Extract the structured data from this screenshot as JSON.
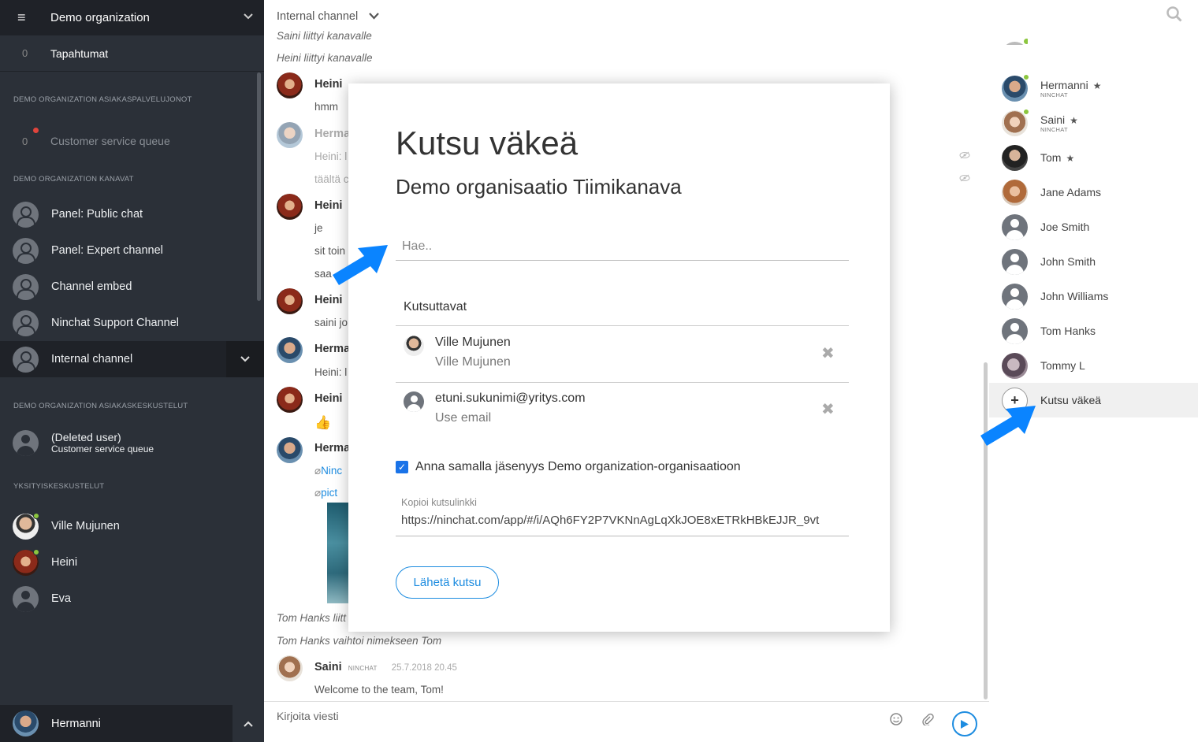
{
  "sidebar": {
    "org_name": "Demo organization",
    "events": {
      "count": "0",
      "label": "Tapahtumat"
    },
    "sections": {
      "queues": "DEMO ORGANIZATION ASIAKASPALVELUJONOT",
      "channels": "DEMO ORGANIZATION KANAVAT",
      "conversations": "DEMO ORGANIZATION ASIAKASKESKUSTELUT",
      "private": "YKSITYISKESKUSTELUT"
    },
    "queue": {
      "count": "0",
      "label": "Customer service queue"
    },
    "channels": [
      {
        "label": "Panel: Public chat"
      },
      {
        "label": "Panel: Expert channel"
      },
      {
        "label": "Channel embed"
      },
      {
        "label": "Ninchat Support Channel"
      },
      {
        "label": "Internal channel"
      }
    ],
    "conversation": {
      "name": "(Deleted user)",
      "queue": "Customer service queue"
    },
    "private_chats": [
      {
        "label": "Ville Mujunen"
      },
      {
        "label": "Heini"
      },
      {
        "label": "Eva"
      }
    ],
    "current_user": "Hermanni"
  },
  "main": {
    "channel_title": "Internal channel",
    "system_top_1": "Saini liittyi kanavalle",
    "system_top_2": "Heini liittyi kanavalle",
    "messages": [
      {
        "name": "Heini",
        "text": "hmm"
      },
      {
        "name": "Herma",
        "text": "Heini: l",
        "text2": "täältä c"
      },
      {
        "name": "Heini",
        "text": "je",
        "text2": "sit toin",
        "text3": "saa"
      },
      {
        "name": "Heini",
        "text": "saini jo"
      },
      {
        "name": "Herma",
        "text": "Heini: l"
      },
      {
        "name": "Heini",
        "text": "👍"
      },
      {
        "name": "Herma",
        "text": "Ninc",
        "text2": "pict"
      }
    ],
    "system_bottom_1": "Tom Hanks liitt",
    "system_bottom_2": "Tom Hanks vaihtoi nimekseen Tom",
    "last_message": {
      "name": "Saini",
      "tag": "NINCHAT",
      "time": "25.7.2018 20.45",
      "text": "Welcome to the team, Tom!"
    },
    "composer_placeholder": "Kirjoita viesti"
  },
  "members": [
    {
      "name": "Hermanni",
      "tag": "NINCHAT",
      "star": "★"
    },
    {
      "name": "Saini",
      "tag": "NINCHAT",
      "star": "★"
    },
    {
      "name": "Tom",
      "star": "★"
    },
    {
      "name": "Jane Adams"
    },
    {
      "name": "Joe Smith"
    },
    {
      "name": "John Smith"
    },
    {
      "name": "John Williams"
    },
    {
      "name": "Tom Hanks"
    },
    {
      "name": "Tommy L"
    }
  ],
  "invite_row": {
    "label": "Kutsu väkeä",
    "plus": "+"
  },
  "modal": {
    "title": "Kutsu väkeä",
    "subtitle": "Demo organisaatio Tiimikanava",
    "search_placeholder": "Hae..",
    "invitees_label": "Kutsuttavat",
    "invitees": [
      {
        "main": "Ville Mujunen",
        "sub": "Ville Mujunen"
      },
      {
        "main": "etuni.sukunimi@yritys.com",
        "sub": "Use email"
      }
    ],
    "membership_label": "Anna samalla jäsenyys Demo organization-organisaatioon",
    "link_label": "Kopioi kutsulinkki",
    "link_value": "https://ninchat.com/app/#/i/AQh6FY2P7VKNnAgLqXkJOE8xETRkHBkEJJR_9vt",
    "send_label": "Lähetä kutsu"
  },
  "icons": {
    "menu": "≡",
    "chevron_down": "⌄",
    "chevron_up": "⌃",
    "close": "✖",
    "check": "✓",
    "send": "▶",
    "emoji": "☺",
    "attach": "📎",
    "search": "⚲",
    "eye": "👁"
  },
  "colors": {
    "sidebar_bg": "#2b3038",
    "accent": "#1d8ce0",
    "online": "#8cc63f",
    "arrow": "#0a84ff"
  }
}
